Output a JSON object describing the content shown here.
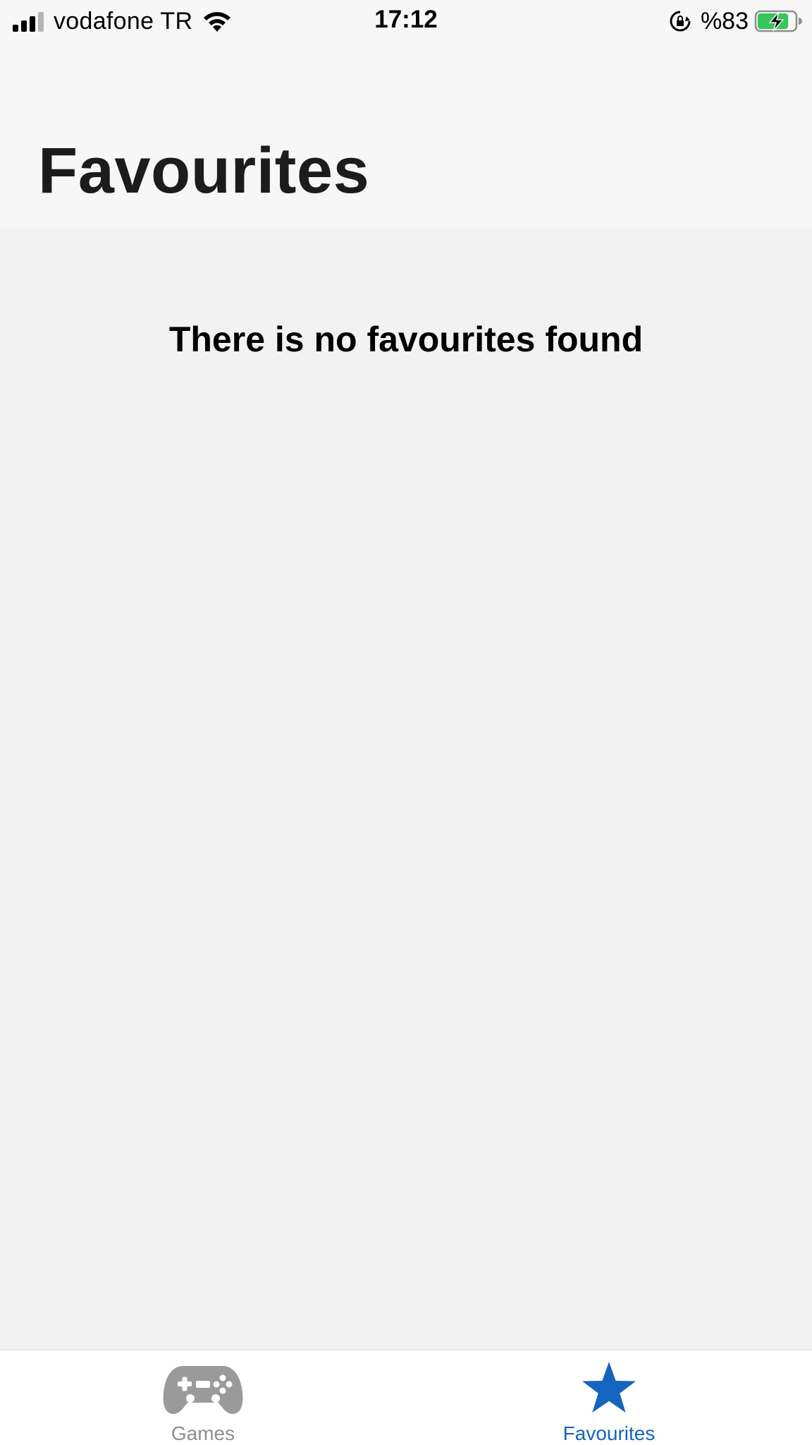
{
  "status_bar": {
    "carrier": "vodafone TR",
    "time": "17:12",
    "battery_percent": "%83",
    "signal_bars": 3,
    "battery_level": 0.83,
    "icons": [
      "signal-icon",
      "wifi-icon",
      "orientation-lock-icon",
      "battery-charging-icon"
    ]
  },
  "header": {
    "title": "Favourites"
  },
  "content": {
    "empty_message": "There is no favourites found"
  },
  "tab_bar": {
    "tabs": [
      {
        "label": "Games",
        "icon": "gamepad-icon",
        "selected": false
      },
      {
        "label": "Favourites",
        "icon": "star-icon",
        "selected": true
      }
    ],
    "colors": {
      "active": "#1565c0",
      "inactive": "#8e8e93"
    }
  }
}
